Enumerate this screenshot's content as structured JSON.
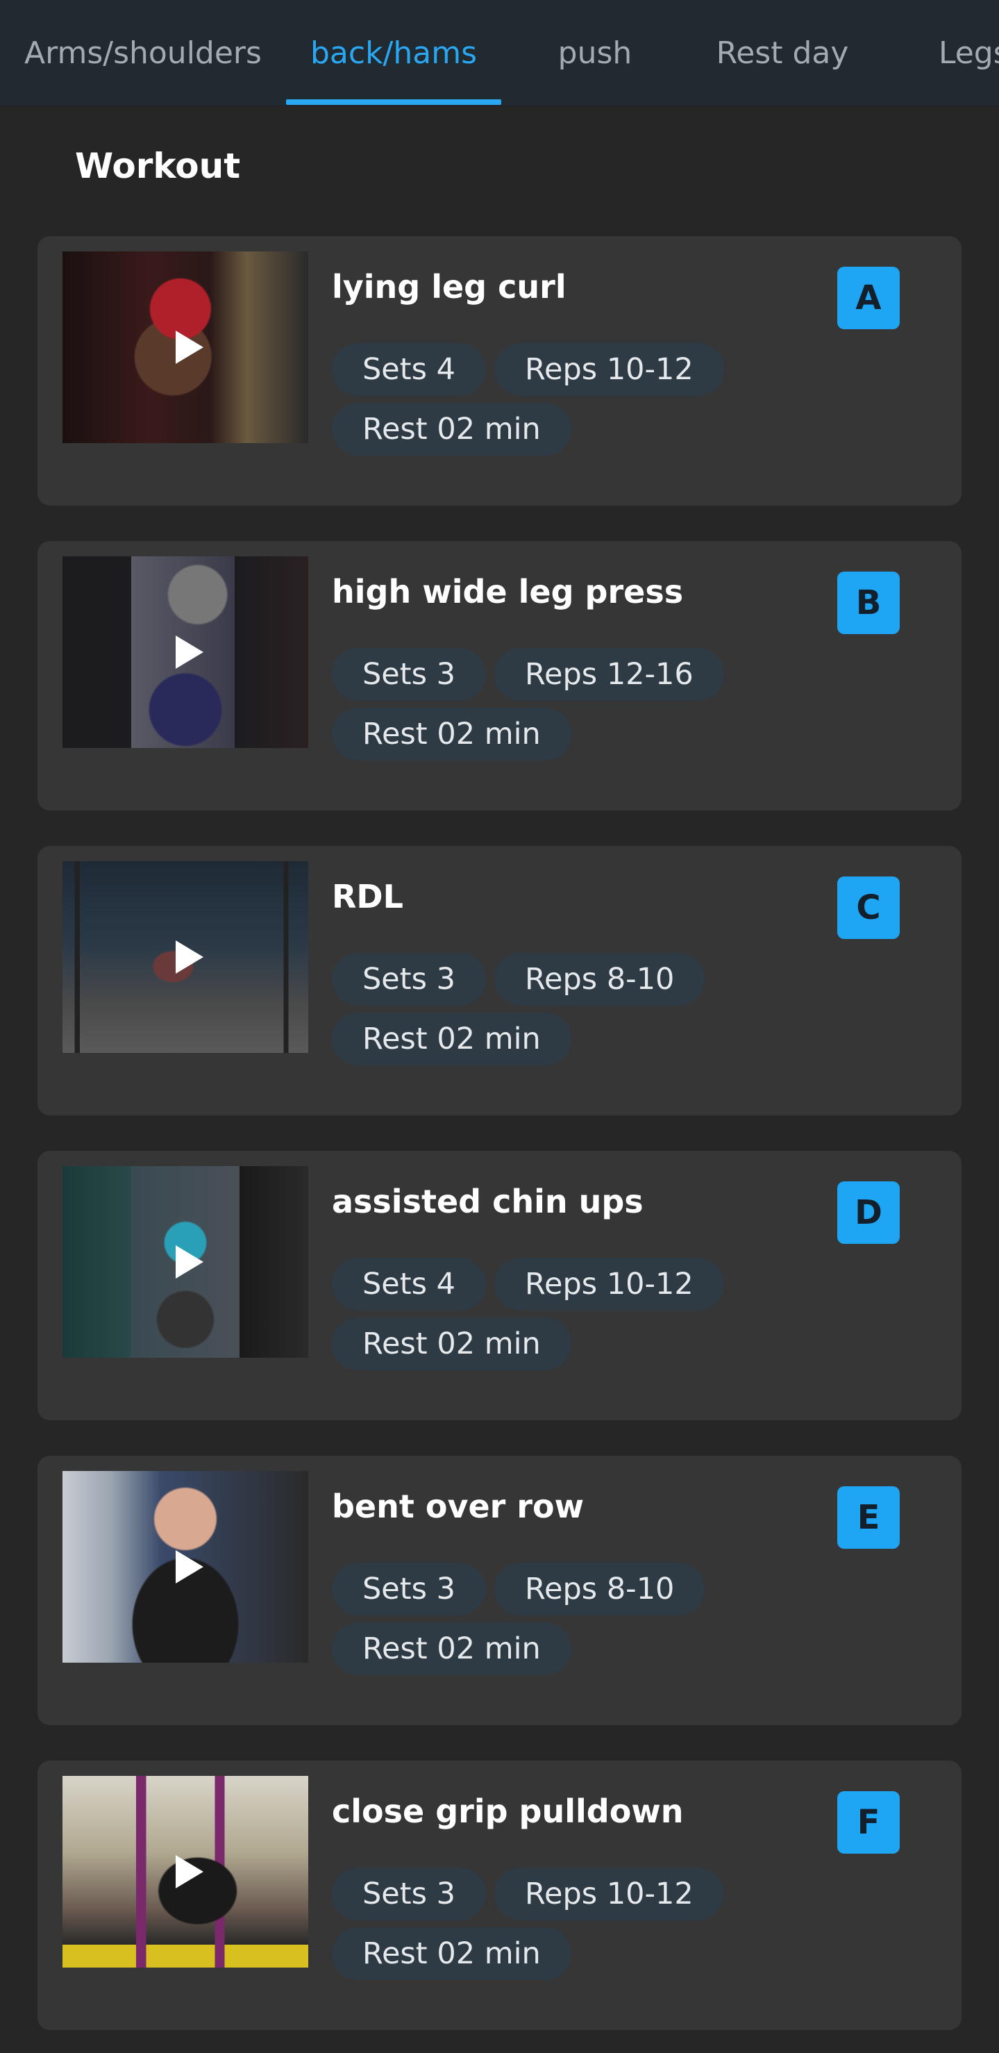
{
  "tabs": [
    {
      "label": "Arms/shoulders",
      "active": false
    },
    {
      "label": "back/hams",
      "active": true
    },
    {
      "label": "push",
      "active": false
    },
    {
      "label": "Rest day",
      "active": false
    },
    {
      "label": "Legs",
      "active": false
    }
  ],
  "section_title": "Workout",
  "labels": {
    "sets": "Sets",
    "reps": "Reps",
    "rest": "Rest"
  },
  "exercises": [
    {
      "letter": "A",
      "name": "lying leg curl",
      "sets": "Sets 4",
      "reps": "Reps 10-12",
      "rest": "Rest 02 min"
    },
    {
      "letter": "B",
      "name": "high wide leg press",
      "sets": "Sets 3",
      "reps": "Reps 12-16",
      "rest": "Rest 02 min"
    },
    {
      "letter": "C",
      "name": "RDL",
      "sets": "Sets 3",
      "reps": "Reps 8-10",
      "rest": "Rest 02 min"
    },
    {
      "letter": "D",
      "name": "assisted chin ups",
      "sets": "Sets 4",
      "reps": "Reps 10-12",
      "rest": "Rest 02 min"
    },
    {
      "letter": "E",
      "name": "bent over row",
      "sets": "Sets 3",
      "reps": "Reps 8-10",
      "rest": "Rest 02 min"
    },
    {
      "letter": "F",
      "name": "close grip pulldown",
      "sets": "Sets 3",
      "reps": "Reps 10-12",
      "rest": "Rest 02 min"
    }
  ],
  "colors": {
    "accent": "#2aa7f2",
    "badge": "#1ea6f4",
    "pill": "#2e3b45",
    "card": "#363636",
    "background": "#262626",
    "tabbar": "#222a31"
  },
  "icons": {
    "play": "play-icon"
  }
}
